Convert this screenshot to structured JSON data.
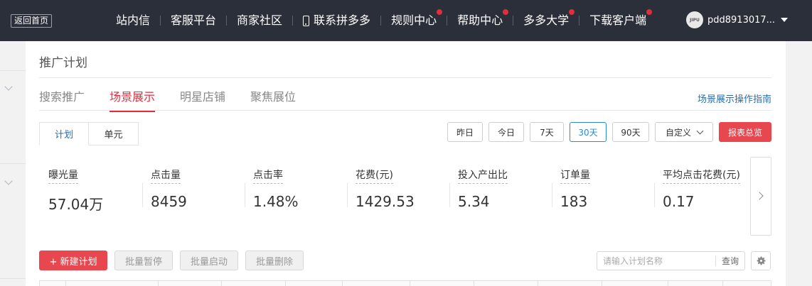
{
  "topbar": {
    "back_label": "返回首页",
    "nav": [
      {
        "label": "站内信",
        "dot": false,
        "icon": ""
      },
      {
        "label": "客服平台",
        "dot": false,
        "icon": ""
      },
      {
        "label": "商家社区",
        "dot": false,
        "icon": ""
      },
      {
        "label": "联系拼多多",
        "dot": false,
        "icon": "phone-icon"
      },
      {
        "label": "规则中心",
        "dot": true,
        "icon": ""
      },
      {
        "label": "帮助中心",
        "dot": true,
        "icon": ""
      },
      {
        "label": "多多大学",
        "dot": true,
        "icon": ""
      },
      {
        "label": "下载客户端",
        "dot": true,
        "icon": ""
      }
    ],
    "user": {
      "avatar_text": "JIPU",
      "name": "pdd8913017..."
    },
    "badge_color": "#e02e3f"
  },
  "page_title": "推广计划",
  "tabs": [
    {
      "label": "搜索推广",
      "active": false
    },
    {
      "label": "场景展示",
      "active": true
    },
    {
      "label": "明星店铺",
      "active": false
    },
    {
      "label": "聚焦展位",
      "active": false
    }
  ],
  "guide_link": "场景展示操作指南",
  "subtabs": [
    {
      "label": "计划",
      "active": true
    },
    {
      "label": "单元",
      "active": false
    }
  ],
  "date_ranges": [
    {
      "label": "昨日",
      "active": false
    },
    {
      "label": "今日",
      "active": false
    },
    {
      "label": "7天",
      "active": false
    },
    {
      "label": "30天",
      "active": true
    },
    {
      "label": "90天",
      "active": false
    }
  ],
  "custom_range_label": "自定义",
  "report_label": "报表总览",
  "metrics": [
    {
      "label": "曝光量",
      "value": "57.04万"
    },
    {
      "label": "点击量",
      "value": "8459"
    },
    {
      "label": "点击率",
      "value": "1.48%"
    },
    {
      "label": "花费(元)",
      "value": "1429.53"
    },
    {
      "label": "投入产出比",
      "value": "5.34"
    },
    {
      "label": "订单量",
      "value": "183"
    },
    {
      "label": "平均点击花费(元)",
      "value": "0.17"
    }
  ],
  "actions": {
    "new_plan": "+ 新建计划",
    "batch_pause": "批量暂停",
    "batch_start": "批量启动",
    "batch_delete": "批量删除"
  },
  "search": {
    "placeholder": "请输入计划名称",
    "value": "",
    "button": "查询"
  },
  "accent_color": "#e8474f",
  "link_color": "#2a6fb0"
}
